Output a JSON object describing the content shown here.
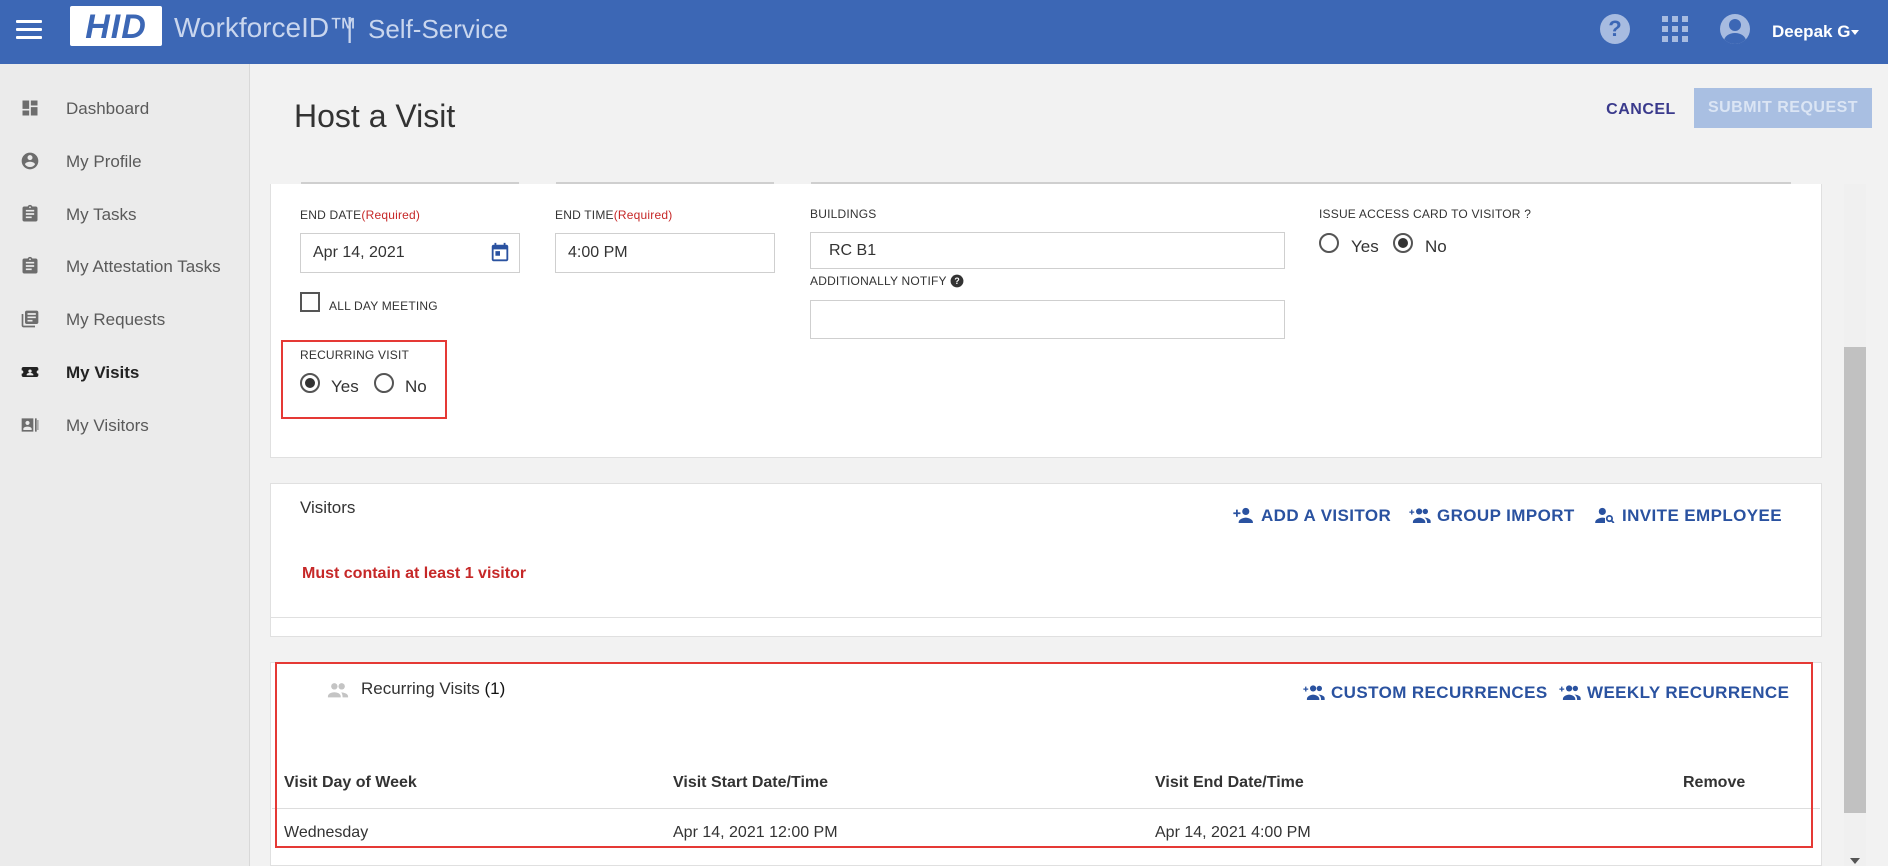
{
  "header": {
    "logo_text": "HID",
    "app_name": "WorkforceID™",
    "separator": "|",
    "app_section": "Self-Service",
    "user_name": "Deepak G"
  },
  "sidebar": {
    "items": [
      {
        "label": "Dashboard",
        "icon": "dashboard-icon"
      },
      {
        "label": "My Profile",
        "icon": "account-circle-icon"
      },
      {
        "label": "My Tasks",
        "icon": "clipboard-icon"
      },
      {
        "label": "My Attestation Tasks",
        "icon": "clipboard-icon"
      },
      {
        "label": "My Requests",
        "icon": "library-books-icon"
      },
      {
        "label": "My Visits",
        "icon": "ticket-icon",
        "active": true
      },
      {
        "label": "My Visitors",
        "icon": "contacts-icon"
      }
    ]
  },
  "page": {
    "title": "Host a Visit",
    "cancel_label": "CANCEL",
    "submit_label": "SUBMIT REQUEST"
  },
  "form": {
    "end_date_label": "END DATE",
    "end_date_required": "(Required)",
    "end_date_value": "Apr 14, 2021",
    "end_time_label": "END TIME",
    "end_time_required": "(Required)",
    "end_time_value": "4:00 PM",
    "buildings_label": "BUILDINGS",
    "buildings_value": "RC B1",
    "notify_label": "ADDITIONALLY NOTIFY",
    "notify_value": "",
    "access_card_label": "ISSUE ACCESS CARD TO VISITOR ?",
    "access_card_yes": "Yes",
    "access_card_no": "No",
    "access_card_selected": "No",
    "all_day_label": "ALL DAY MEETING",
    "all_day_checked": false,
    "recurring_label": "RECURRING VISIT",
    "recurring_yes": "Yes",
    "recurring_no": "No",
    "recurring_selected": "Yes"
  },
  "visitors": {
    "title": "Visitors",
    "add_label": "ADD A VISITOR",
    "group_import_label": "GROUP IMPORT",
    "invite_label": "INVITE EMPLOYEE",
    "error": "Must contain at least 1 visitor"
  },
  "recurring": {
    "title": "Recurring Visits",
    "count": "(1)",
    "custom_label": "CUSTOM RECURRENCES",
    "weekly_label": "WEEKLY RECURRENCE",
    "columns": [
      "Visit Day of Week",
      "Visit Start Date/Time",
      "Visit End Date/Time",
      "Remove"
    ],
    "rows": [
      {
        "day": "Wednesday",
        "start": "Apr 14, 2021 12:00 PM",
        "end": "Apr 14, 2021 4:00 PM"
      }
    ]
  },
  "colors": {
    "header_bg": "#3c67b5",
    "link": "#2a52a0",
    "error": "#c62828",
    "highlight_box": "#e53935"
  }
}
